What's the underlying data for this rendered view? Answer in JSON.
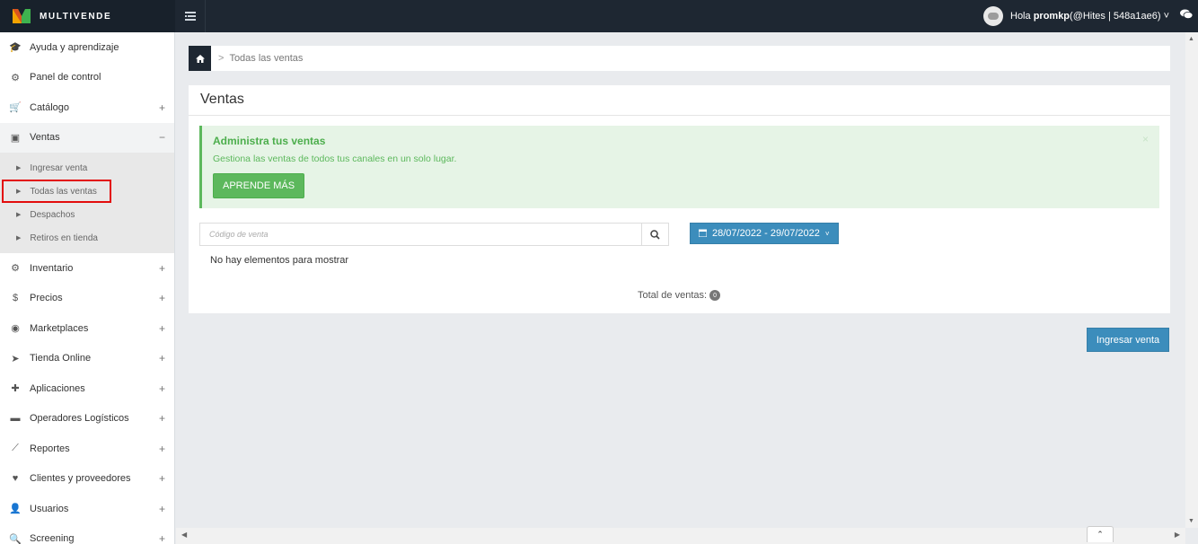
{
  "brand": {
    "name": "MULTIVENDE",
    "logo_icon": "multivende-logo-icon"
  },
  "header": {
    "greeting_prefix": "Hola ",
    "username": "promkp",
    "account": " (@Hites | 548a1ae6)",
    "chevron": "˅",
    "menu_icon": "list-icon",
    "chat_icon": "chat-icon"
  },
  "sidebar": {
    "items": [
      {
        "label": "Ayuda y aprendizaje",
        "icon": "🎓",
        "plus": ""
      },
      {
        "label": "Panel de control",
        "icon": "⚙",
        "plus": ""
      },
      {
        "label": "Catálogo",
        "icon": "🛒",
        "plus": "+"
      },
      {
        "label": "Ventas",
        "icon": "▣",
        "plus": "−"
      },
      {
        "label": "Inventario",
        "icon": "⚙",
        "plus": "+"
      },
      {
        "label": "Precios",
        "icon": "$",
        "plus": "+"
      },
      {
        "label": "Marketplaces",
        "icon": "◉",
        "plus": "+"
      },
      {
        "label": "Tienda Online",
        "icon": "➤",
        "plus": "+"
      },
      {
        "label": "Aplicaciones",
        "icon": "✚",
        "plus": "+"
      },
      {
        "label": "Operadores Logísticos",
        "icon": "▬",
        "plus": "+"
      },
      {
        "label": "Reportes",
        "icon": "⟋",
        "plus": "+"
      },
      {
        "label": "Clientes y proveedores",
        "icon": "♥",
        "plus": "+"
      },
      {
        "label": "Usuarios",
        "icon": "👤",
        "plus": "+"
      },
      {
        "label": "Screening",
        "icon": "🔍",
        "plus": "+"
      }
    ],
    "sub_items": [
      {
        "label": "Ingresar venta"
      },
      {
        "label": "Todas las ventas"
      },
      {
        "label": "Despachos"
      },
      {
        "label": "Retiros en tienda"
      }
    ]
  },
  "breadcrumb": {
    "current": "Todas las ventas"
  },
  "panel": {
    "title": "Ventas",
    "alert": {
      "title": "Administra tus ventas",
      "text": "Gestiona las ventas de todos tus canales en un solo lugar.",
      "button": "APRENDE MÁS",
      "close": "×"
    },
    "search": {
      "placeholder": "Código de venta"
    },
    "date_range": "28/07/2022 - 29/07/2022",
    "empty_message": "No hay elementos para mostrar",
    "total_label": "Total de ventas:",
    "total_count": "0"
  },
  "actions": {
    "add_sale": "Ingresar venta"
  }
}
